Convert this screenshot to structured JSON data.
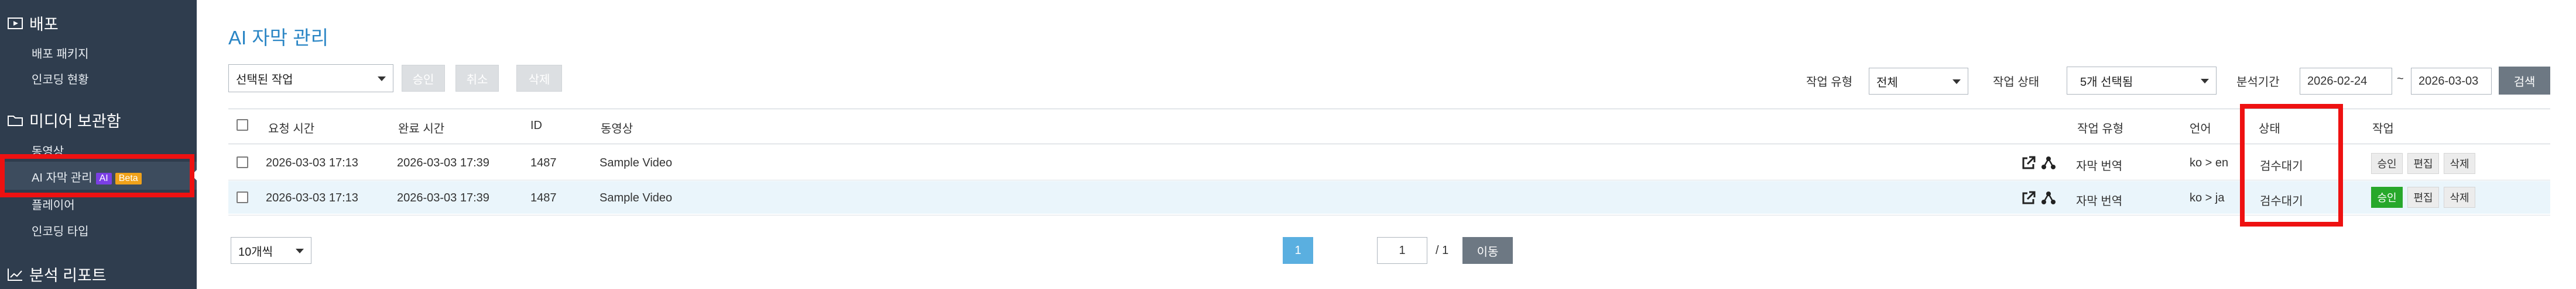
{
  "sidebar": {
    "sections": [
      {
        "label": "배포",
        "icon": "deploy-icon"
      },
      {
        "label": "미디어 보관함",
        "icon": "folder-icon"
      },
      {
        "label": "분석 리포트",
        "icon": "chart-icon"
      }
    ],
    "items": [
      {
        "label": "배포 패키지"
      },
      {
        "label": "인코딩 현황"
      },
      {
        "label": "동영상"
      },
      {
        "label": "AI 자막 관리",
        "badge_ai": "AI",
        "badge_beta": "Beta"
      },
      {
        "label": "플레이어"
      },
      {
        "label": "인코딩 타입"
      }
    ]
  },
  "page": {
    "title": "AI 자막 관리"
  },
  "toolbar": {
    "selected_action": "선택된 작업",
    "approve": "승인",
    "cancel": "취소",
    "delete": "삭제"
  },
  "filters": {
    "job_type_label": "작업 유형",
    "job_type_value": "전체",
    "job_status_label": "작업 상태",
    "job_status_value": "5개 선택됨",
    "period_label": "분석기간",
    "start_date": "2026-02-24",
    "tilde": "~",
    "end_date": "2026-03-03",
    "search": "검색"
  },
  "table": {
    "headers": {
      "requested": "요청 시간",
      "completed": "완료 시간",
      "id": "ID",
      "video": "동영상",
      "job_type": "작업 유형",
      "language": "언어",
      "status": "상태",
      "action": "작업"
    },
    "rows": [
      {
        "requested": "2026-03-03 17:13",
        "completed": "2026-03-03 17:39",
        "id": "1487",
        "video": "Sample Video",
        "job_type": "자막 번역",
        "language": "ko > en",
        "status": "검수대기",
        "approve": "승인",
        "edit": "편집",
        "delete": "삭제",
        "approve_active": false
      },
      {
        "requested": "2026-03-03 17:13",
        "completed": "2026-03-03 17:39",
        "id": "1487",
        "video": "Sample Video",
        "job_type": "자막 번역",
        "language": "ko > ja",
        "status": "검수대기",
        "approve": "승인",
        "edit": "편집",
        "delete": "삭제",
        "approve_active": true
      }
    ]
  },
  "footer": {
    "page_size": "10개씩",
    "current_page": "1",
    "page_input": "1",
    "total_pages": "/ 1",
    "go": "이동"
  },
  "colors": {
    "sidebar_bg": "#2f3d4e",
    "accent_blue": "#2b86c5",
    "highlight_red": "#ee1111",
    "approve_green": "#27a82b",
    "ai_badge": "#7b3fe4",
    "beta_badge": "#f0a21a"
  }
}
